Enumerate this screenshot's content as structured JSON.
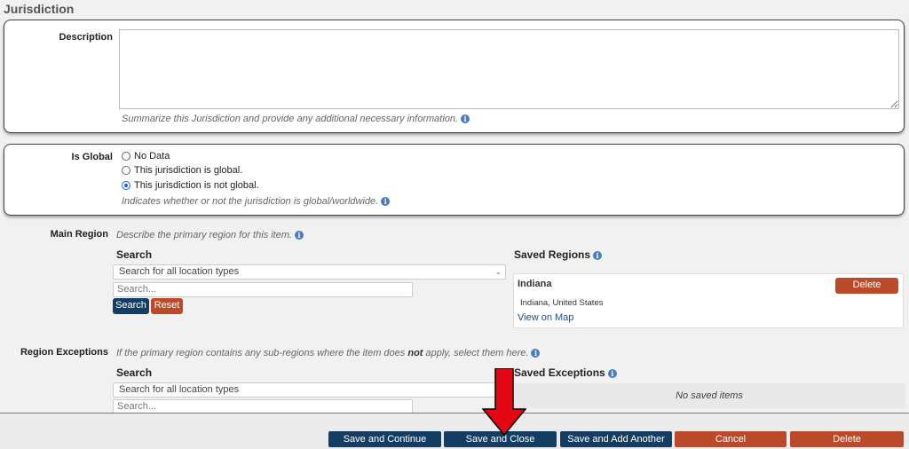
{
  "section": {
    "title": "Jurisdiction"
  },
  "description": {
    "label": "Description",
    "value": "",
    "help": "Summarize this Jurisdiction and provide any additional necessary information."
  },
  "is_global": {
    "label": "Is Global",
    "options": [
      "No Data",
      "This jurisdiction is global.",
      "This jurisdiction is not global."
    ],
    "selected_index": 2,
    "help": "Indicates whether or not the jurisdiction is global/worldwide."
  },
  "main_region": {
    "label": "Main Region",
    "help": "Describe the primary region for this item.",
    "search_heading": "Search",
    "type_select": "Search for all location types",
    "search_placeholder": "Search...",
    "search_button": "Search",
    "reset_button": "Reset",
    "saved_heading": "Saved Regions",
    "saved_items": [
      {
        "name": "Indiana",
        "location": "Indiana, United States",
        "link": "View on Map",
        "delete_label": "Delete"
      }
    ]
  },
  "region_exceptions": {
    "label": "Region Exceptions",
    "help_before": "If the primary region contains any sub-regions where the item does ",
    "help_bold": "not",
    "help_after": " apply, select them here.",
    "search_heading": "Search",
    "type_select": "Search for all location types",
    "search_placeholder": "Search...",
    "saved_heading": "Saved Exceptions",
    "empty_text": "No saved items"
  },
  "footer": {
    "save_continue": "Save and Continue",
    "save_close": "Save and Close",
    "save_add": "Save and Add Another",
    "cancel": "Cancel",
    "delete": "Delete"
  },
  "colors": {
    "primary": "#133d63",
    "danger": "#bb4a2b",
    "link": "#1c4e8a",
    "annotation_arrow": "#e30613"
  },
  "icons": {
    "help": "info-icon",
    "dropdown": "chevron-down-icon",
    "annotation": "arrow-down-icon"
  }
}
